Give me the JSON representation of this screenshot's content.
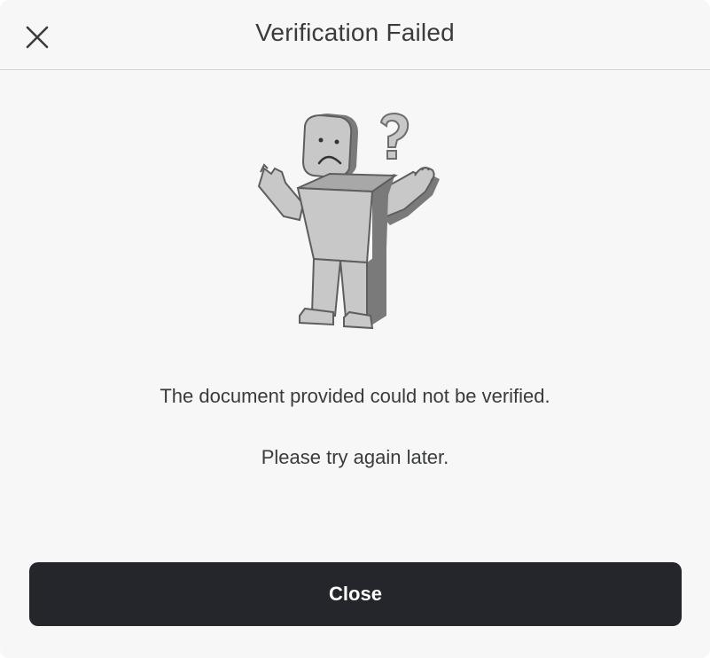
{
  "dialog": {
    "title": "Verification Failed",
    "message_primary": "The document provided could not be verified.",
    "message_secondary": "Please try again later.",
    "close_button_label": "Close",
    "close_icon": "close-x-icon",
    "illustration": "confused-figure-illustration"
  },
  "colors": {
    "background": "#f7f7f7",
    "text": "#393b3d",
    "button_bg": "#24262b",
    "button_text": "#ffffff",
    "divider": "#d4d4d4"
  }
}
